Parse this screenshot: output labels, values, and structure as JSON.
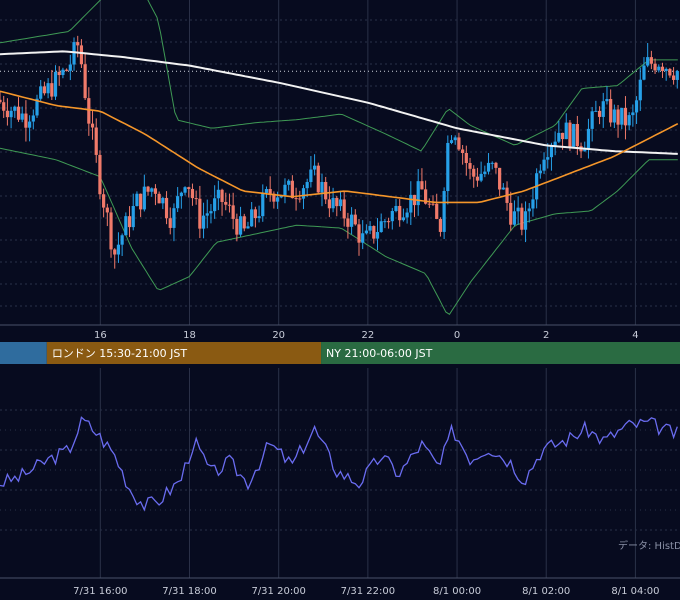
{
  "chart_data": [
    {
      "type": "candlestick",
      "title": "",
      "grid": true,
      "colors": {
        "up": "#26a0e8",
        "down": "#f07a6a",
        "ma_long": "#f2f2f2",
        "ma_mid": "#f5962a",
        "bollinger": "#3f9a55",
        "grid": "#2a3148",
        "reference_line": "#cfd3dd"
      },
      "x_ticks": [
        "16",
        "18",
        "20",
        "22",
        "0",
        "2",
        "4"
      ],
      "x_tick_hours": [
        16,
        18,
        20,
        22,
        24,
        26,
        28
      ],
      "x_range_hours": [
        13.75,
        29.0
      ],
      "y_range": [
        0,
        100
      ],
      "reference_level": 82,
      "ohlc_keyframes": [
        [
          13.75,
          72
        ],
        [
          14.4,
          66
        ],
        [
          15.0,
          77
        ],
        [
          15.35,
          83
        ],
        [
          15.6,
          92
        ],
        [
          15.8,
          68
        ],
        [
          16.05,
          45
        ],
        [
          16.4,
          18
        ],
        [
          16.55,
          24
        ],
        [
          16.9,
          36
        ],
        [
          17.3,
          42
        ],
        [
          17.7,
          30
        ],
        [
          18.0,
          46
        ],
        [
          18.3,
          30
        ],
        [
          18.8,
          37
        ],
        [
          19.3,
          25
        ],
        [
          19.9,
          40
        ],
        [
          20.4,
          40
        ],
        [
          20.9,
          45
        ],
        [
          21.3,
          35
        ],
        [
          21.7,
          30
        ],
        [
          22.0,
          22
        ],
        [
          22.6,
          32
        ],
        [
          23.3,
          40
        ],
        [
          23.7,
          26
        ],
        [
          23.85,
          55
        ],
        [
          24.0,
          64
        ],
        [
          24.4,
          45
        ],
        [
          24.9,
          48
        ],
        [
          25.3,
          32
        ],
        [
          25.6,
          28
        ],
        [
          26.0,
          54
        ],
        [
          26.4,
          62
        ],
        [
          26.9,
          57
        ],
        [
          27.3,
          70
        ],
        [
          27.6,
          66
        ],
        [
          28.0,
          64
        ],
        [
          28.3,
          84
        ],
        [
          28.6,
          86
        ],
        [
          29.0,
          82
        ]
      ],
      "ma_long_keyframes": [
        [
          13.75,
          88
        ],
        [
          15.2,
          89
        ],
        [
          16.5,
          87
        ],
        [
          18.0,
          84
        ],
        [
          20.0,
          78
        ],
        [
          22.0,
          71
        ],
        [
          24.0,
          62
        ],
        [
          26.0,
          56
        ],
        [
          27.5,
          54
        ],
        [
          29.0,
          53
        ]
      ],
      "ma_mid_keyframes": [
        [
          13.75,
          75
        ],
        [
          15.0,
          70
        ],
        [
          16.0,
          68
        ],
        [
          17.0,
          60
        ],
        [
          18.2,
          48
        ],
        [
          19.2,
          40
        ],
        [
          20.3,
          38
        ],
        [
          21.5,
          40
        ],
        [
          22.5,
          38
        ],
        [
          23.5,
          36
        ],
        [
          24.5,
          36
        ],
        [
          25.5,
          40
        ],
        [
          26.5,
          46
        ],
        [
          27.5,
          52
        ],
        [
          28.5,
          60
        ],
        [
          29.0,
          64
        ]
      ],
      "bb_upper_keyframes": [
        [
          13.75,
          92
        ],
        [
          15.3,
          96
        ],
        [
          16.0,
          107
        ],
        [
          16.7,
          118
        ],
        [
          17.3,
          100
        ],
        [
          17.7,
          65
        ],
        [
          18.5,
          62
        ],
        [
          19.5,
          64
        ],
        [
          20.4,
          65
        ],
        [
          21.4,
          67
        ],
        [
          22.4,
          60
        ],
        [
          23.2,
          54
        ],
        [
          23.8,
          69
        ],
        [
          24.3,
          63
        ],
        [
          25.3,
          56
        ],
        [
          26.2,
          63
        ],
        [
          26.8,
          76
        ],
        [
          27.6,
          77
        ],
        [
          28.3,
          86
        ],
        [
          29.0,
          86
        ]
      ],
      "bb_lower_keyframes": [
        [
          13.75,
          55
        ],
        [
          15.0,
          51
        ],
        [
          16.0,
          45
        ],
        [
          16.7,
          20
        ],
        [
          17.3,
          5
        ],
        [
          18.0,
          10
        ],
        [
          18.6,
          22
        ],
        [
          19.5,
          25
        ],
        [
          20.4,
          28
        ],
        [
          21.4,
          27
        ],
        [
          22.4,
          17
        ],
        [
          23.3,
          11
        ],
        [
          23.8,
          -4
        ],
        [
          24.3,
          8
        ],
        [
          25.3,
          28
        ],
        [
          26.2,
          32
        ],
        [
          27.0,
          33
        ],
        [
          27.6,
          40
        ],
        [
          28.3,
          51
        ],
        [
          29.0,
          51
        ]
      ]
    },
    {
      "type": "line",
      "title": "",
      "grid": true,
      "color": "#6a6cf0",
      "x_ticks": [
        "7/31 16:00",
        "7/31 18:00",
        "7/31 20:00",
        "7/31 22:00",
        "8/1 00:00",
        "8/1 02:00",
        "8/1 04:00"
      ],
      "x_tick_hours": [
        16,
        18,
        20,
        22,
        24,
        26,
        28
      ],
      "x_range_hours": [
        13.75,
        29.0
      ],
      "y_range": [
        0,
        100
      ],
      "keyframes": [
        [
          13.75,
          30
        ],
        [
          14.2,
          34
        ],
        [
          14.8,
          45
        ],
        [
          15.3,
          52
        ],
        [
          15.6,
          72
        ],
        [
          15.9,
          64
        ],
        [
          16.3,
          50
        ],
        [
          16.7,
          24
        ],
        [
          17.0,
          15
        ],
        [
          17.3,
          18
        ],
        [
          17.8,
          32
        ],
        [
          18.1,
          58
        ],
        [
          18.5,
          36
        ],
        [
          18.9,
          44
        ],
        [
          19.3,
          30
        ],
        [
          19.8,
          56
        ],
        [
          20.3,
          42
        ],
        [
          20.8,
          66
        ],
        [
          21.3,
          38
        ],
        [
          21.8,
          30
        ],
        [
          22.3,
          48
        ],
        [
          22.7,
          36
        ],
        [
          23.2,
          56
        ],
        [
          23.6,
          40
        ],
        [
          23.9,
          66
        ],
        [
          24.3,
          46
        ],
        [
          24.7,
          54
        ],
        [
          25.2,
          44
        ],
        [
          25.5,
          32
        ],
        [
          25.9,
          52
        ],
        [
          26.4,
          58
        ],
        [
          26.9,
          66
        ],
        [
          27.3,
          58
        ],
        [
          27.8,
          68
        ],
        [
          28.3,
          70
        ],
        [
          28.7,
          65
        ],
        [
          29.0,
          62
        ]
      ]
    }
  ],
  "sessions": [
    {
      "label": "",
      "color": "#2f6c9e",
      "start_hour": 13.75,
      "end_hour": 14.8
    },
    {
      "label": "ロンドン 15:30-21:00 JST",
      "color": "#8a5a12",
      "start_hour": 14.8,
      "end_hour": 20.95
    },
    {
      "label": "NY 21:00-06:00 JST",
      "color": "#2a6b42",
      "start_hour": 20.95,
      "end_hour": 29.0
    }
  ],
  "credit": "データ: HistData"
}
